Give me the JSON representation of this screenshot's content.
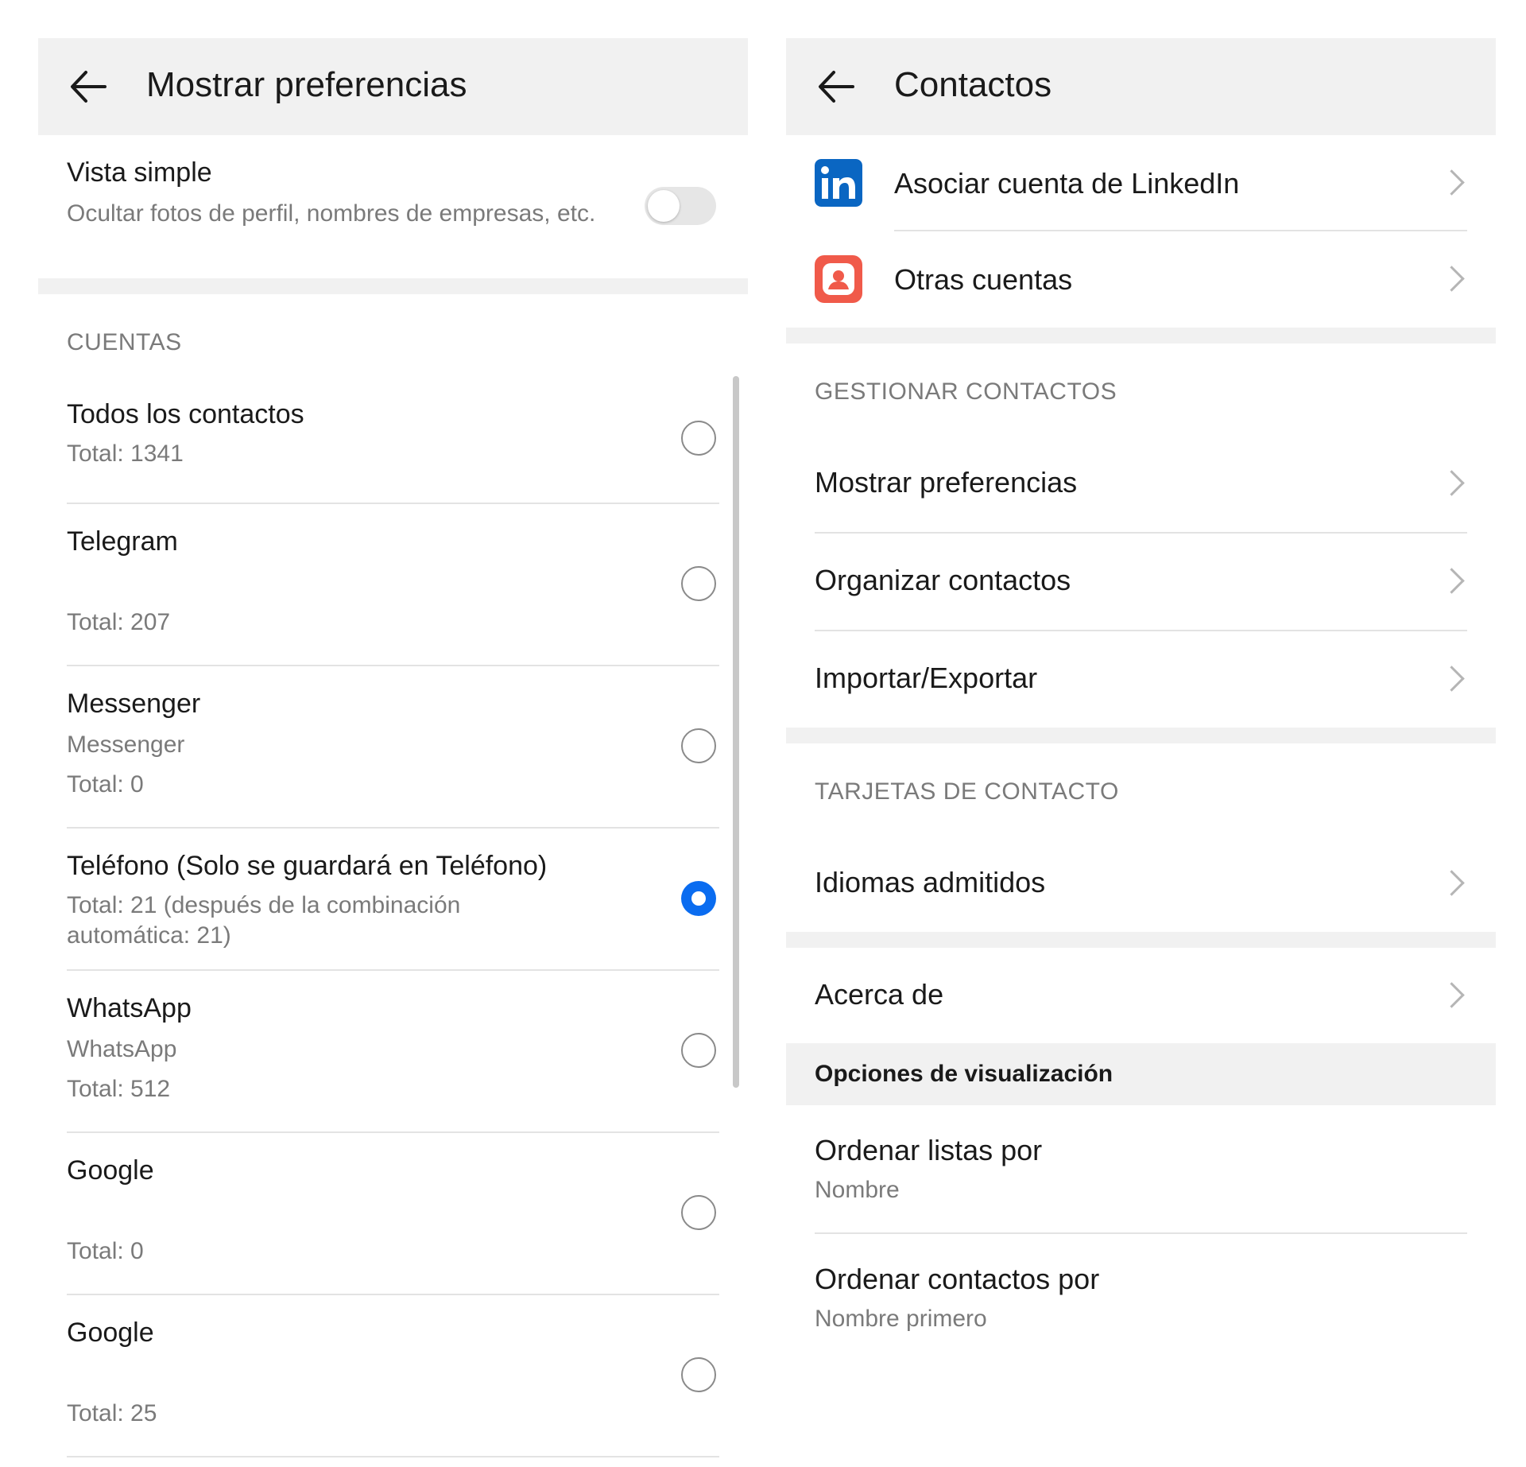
{
  "left_panel": {
    "title": "Mostrar preferencias",
    "simple_view": {
      "title": "Vista simple",
      "subtitle": "Ocultar fotos de perfil, nombres de empresas, etc.",
      "enabled": false
    },
    "accounts_section": "CUENTAS",
    "accounts": [
      {
        "name": "Todos los contactos",
        "detail": "",
        "total": "Total: 1341",
        "selected": false
      },
      {
        "name": "Telegram",
        "detail": "",
        "total": "Total: 207",
        "selected": false
      },
      {
        "name": "Messenger",
        "detail": "Messenger",
        "total": "Total: 0",
        "selected": false
      },
      {
        "name": "Teléfono (Solo se guardará en Teléfono)",
        "detail": "",
        "total": "Total: 21 (después de la combinación automática: 21)",
        "selected": true
      },
      {
        "name": "WhatsApp",
        "detail": "WhatsApp",
        "total": "Total: 512",
        "selected": false
      },
      {
        "name": "Google",
        "detail": "",
        "total": "Total: 0",
        "selected": false
      },
      {
        "name": "Google",
        "detail": "",
        "total": "Total: 25",
        "selected": false
      }
    ]
  },
  "right_panel": {
    "title": "Contactos",
    "linked_accounts": [
      {
        "label": "Asociar cuenta de LinkedIn",
        "icon": "linkedin-icon",
        "color": "#0a66c2"
      },
      {
        "label": "Otras cuentas",
        "icon": "account-icon",
        "color": "#f05a4a"
      }
    ],
    "manage_section": "GESTIONAR CONTACTOS",
    "manage_items": [
      "Mostrar preferencias",
      "Organizar contactos",
      "Importar/Exportar"
    ],
    "cards_section": "TARJETAS DE CONTACTO",
    "cards_items": [
      "Idiomas admitidos"
    ],
    "about": "Acerca de",
    "display_options": {
      "header": "Opciones de visualización",
      "sort_lists": {
        "label": "Ordenar listas por",
        "value": "Nombre"
      },
      "sort_contacts": {
        "label": "Ordenar contactos por",
        "value": "Nombre primero"
      }
    }
  },
  "colors": {
    "accent": "#0a6cf0",
    "header_bg": "#f1f1f1",
    "secondary_text": "#7a7a7a"
  }
}
